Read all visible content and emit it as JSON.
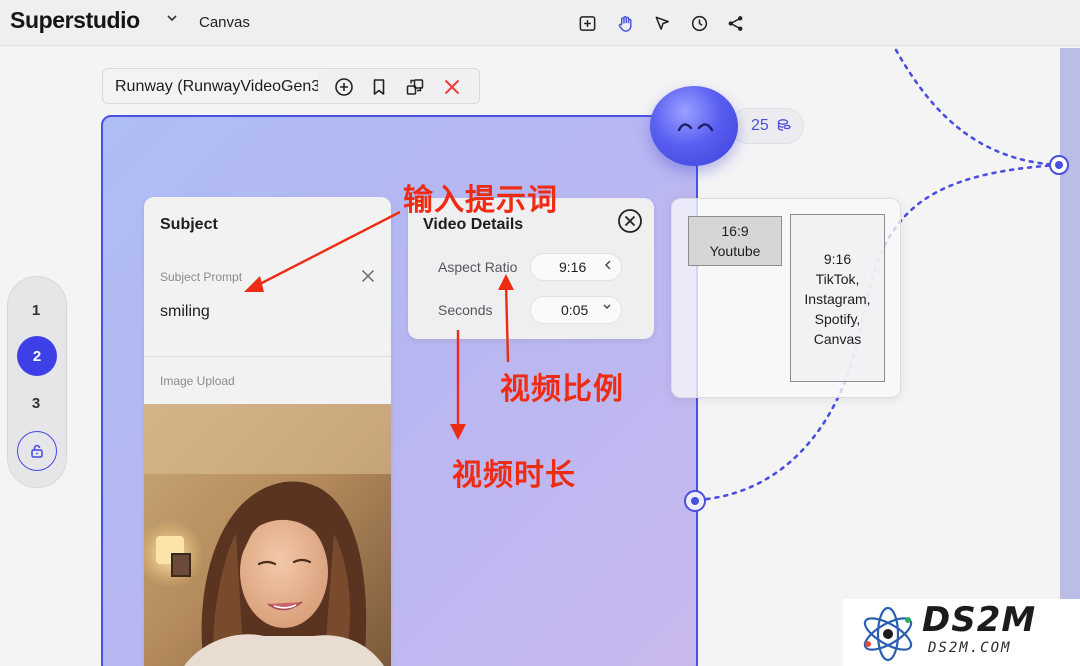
{
  "topbar": {
    "brand": "Superstudio",
    "brand_chevron": "⌄",
    "breadcrumb": "Canvas",
    "tools": [
      "add-frame-icon",
      "hand-icon",
      "pointer-icon",
      "history-icon",
      "share-icon"
    ],
    "active_tool": "hand-icon"
  },
  "node": {
    "title": "Runway (RunwayVideoGen3)",
    "actions": [
      "add-circle-icon",
      "bookmark-icon",
      "swap-icon",
      "close-icon"
    ],
    "credits": "25",
    "credit_icon": "coins-icon"
  },
  "subject": {
    "title": "Subject",
    "prompt_label": "Subject Prompt",
    "prompt_value": "smiling",
    "upload_label": "Image Upload"
  },
  "video_details": {
    "title": "Video Details",
    "aspect_label": "Aspect Ratio",
    "aspect_value": "9:16",
    "aspect_chevron": "‹",
    "seconds_label": "Seconds",
    "seconds_value": "0:05",
    "seconds_chevron": "⌄"
  },
  "ratio_options": [
    {
      "ratio": "16:9",
      "platforms": [
        "Youtube"
      ]
    },
    {
      "ratio": "9:16",
      "platforms": [
        "TikTok,",
        "Instagram,",
        "Spotify,",
        "Canvas"
      ]
    }
  ],
  "steps": {
    "items": [
      "1",
      "2",
      "3"
    ],
    "active": "2",
    "lock_icon": "unlock-icon"
  },
  "annotations": {
    "prompt": "输入提示词",
    "ratio": "视频比例",
    "duration": "视频时长"
  },
  "watermark": {
    "main": "DS2M",
    "sub": "DS2M.COM"
  },
  "colors": {
    "accent": "#3d40e6",
    "annotation": "#ee2c13",
    "connector": "#4a4fe0"
  }
}
